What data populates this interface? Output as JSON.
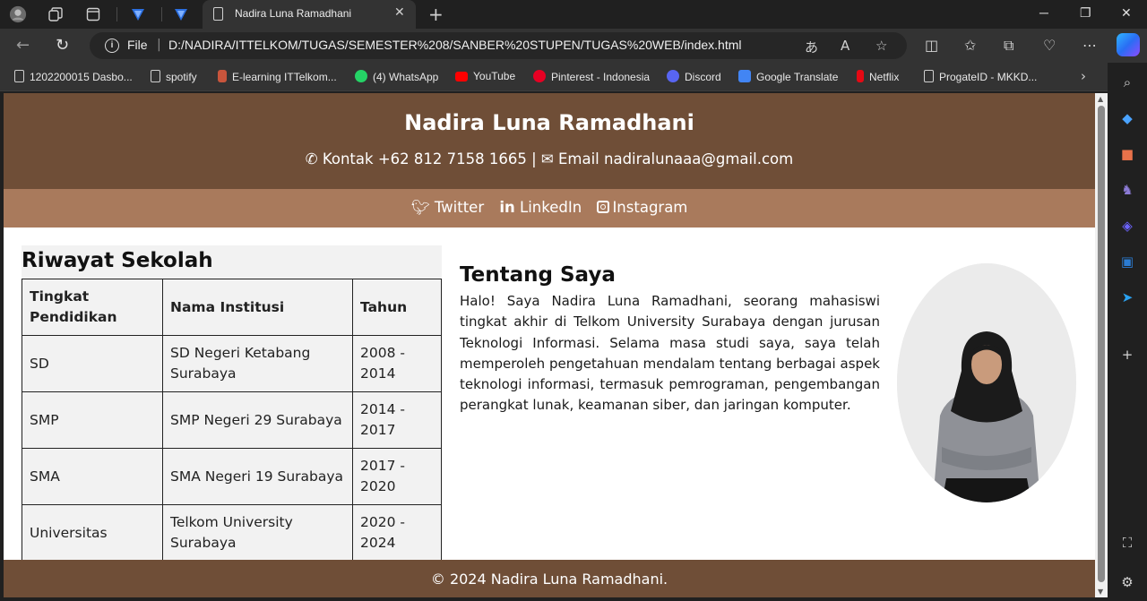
{
  "browser": {
    "tab_title": "Nadira Luna Ramadhani",
    "url_scheme": "File",
    "url": "D:/NADIRA/ITTELKOM/TUGAS/SEMESTER%208/SANBER%20STUPEN/TUGAS%20WEB/index.html"
  },
  "bookmarks": [
    {
      "label": "1202200015 Dasbo...",
      "icon": "doc-icon"
    },
    {
      "label": "spotify",
      "icon": "doc-icon"
    },
    {
      "label": "E-learning ITTelkom...",
      "icon": "elearning-icon"
    },
    {
      "label": "(4) WhatsApp",
      "icon": "whatsapp-icon"
    },
    {
      "label": "YouTube",
      "icon": "youtube-icon"
    },
    {
      "label": "Pinterest - Indonesia",
      "icon": "pinterest-icon"
    },
    {
      "label": "Discord",
      "icon": "discord-icon"
    },
    {
      "label": "Google Translate",
      "icon": "translate-icon"
    },
    {
      "label": "Netflix",
      "icon": "netflix-icon"
    },
    {
      "label": "ProgateID - MKKD...",
      "icon": "doc-icon"
    }
  ],
  "page": {
    "name": "Nadira Luna Ramadhani",
    "contact_label": "Kontak",
    "phone": "+62 812 7158 1665",
    "separator": "|",
    "email_label": "Email",
    "email": "nadiralunaaa@gmail.com",
    "social": [
      "Twitter",
      "LinkedIn",
      "Instagram"
    ],
    "school_title": "Riwayat Sekolah",
    "table_headers": [
      "Tingkat Pendidikan",
      "Nama Institusi",
      "Tahun"
    ],
    "table_rows": [
      [
        "SD",
        "SD Negeri Ketabang Surabaya",
        "2008 - 2014"
      ],
      [
        "SMP",
        "SMP Negeri 29 Surabaya",
        "2014 - 2017"
      ],
      [
        "SMA",
        "SMA Negeri 19 Surabaya",
        "2017 - 2020"
      ],
      [
        "Universitas",
        "Telkom University Surabaya",
        "2020 - 2024"
      ]
    ],
    "about_title": "Tentang Saya",
    "about_text": "Halo! Saya Nadira Luna Ramadhani, seorang mahasiswi tingkat akhir di Telkom University Surabaya dengan jurusan Teknologi Informasi. Selama masa studi saya, saya telah memperoleh pengetahuan mendalam tentang berbagai aspek teknologi informasi, termasuk pemrograman, pengembangan perangkat lunak, keamanan siber, dan jaringan komputer.",
    "footer": "© 2024 Nadira Luna Ramadhani."
  },
  "colors": {
    "header_brown": "#6f4e37",
    "social_brown": "#a97a5c",
    "browser_dark": "#202020",
    "toolbar": "#333333"
  }
}
